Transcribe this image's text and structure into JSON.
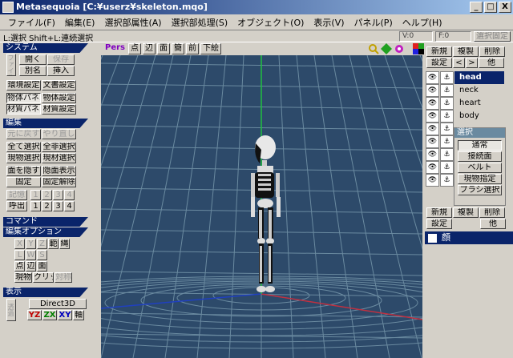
{
  "window": {
    "title": "Metasequoia [C:¥userz¥skeleton.mqo]",
    "buttons": [
      "_",
      "□",
      "X"
    ]
  },
  "menu": [
    "ファイル(F)",
    "編集(E)",
    "選択部属性(A)",
    "選択部処理(S)",
    "オブジェクト(O)",
    "表示(V)",
    "パネル(P)",
    "ヘルプ(H)"
  ],
  "status": {
    "hint": "L:選択  Shift+L:連続選択",
    "v": "V:0",
    "f": "F:0",
    "fix": "選択固定"
  },
  "left": {
    "system_head": "システム",
    "system_rows": [
      [
        "開く",
        "保存"
      ],
      [
        "別名",
        "挿入"
      ]
    ],
    "system_side": "ファイル",
    "env": [
      "環境設定",
      "文書設定"
    ],
    "panels": [
      [
        "物体パネル",
        "物体設定"
      ],
      [
        "材質パネル",
        "材質設定"
      ]
    ],
    "edit_head": "編集",
    "undo": [
      "元に戻す",
      "やり直し"
    ],
    "select": [
      [
        "全て選択",
        "全非選択"
      ],
      [
        "現物選択",
        "現材選択"
      ]
    ],
    "hide": [
      [
        "面を隠す",
        "隠面表示"
      ],
      [
        "固定",
        "固定解除"
      ]
    ],
    "memory": [
      "記憶",
      "呼出"
    ],
    "nums": [
      "1",
      "2",
      "3",
      "4"
    ],
    "cmd_head": "コマンド",
    "opt_head": "編集オプション",
    "xyz": [
      "X",
      "Y",
      "Z",
      "範",
      "縄"
    ],
    "luvws": [
      "L",
      "W",
      "S"
    ],
    "pts": [
      "点",
      "辺",
      "面"
    ],
    "objs": [
      "現物",
      "クリッド",
      "対称"
    ],
    "disp_head": "表示",
    "d3d": "Direct3D",
    "axes": [
      "YZ",
      "ZX",
      "XY",
      "軸"
    ],
    "side2": "透過"
  },
  "viewport": {
    "pers": "Pers",
    "modes": [
      "点",
      "辺",
      "面",
      "簡",
      "前",
      "下絵"
    ],
    "colors": {
      "bg": "#2d4a6a",
      "grid": "#6a8aa0",
      "yaxis": "#20c040",
      "xaxis": "#c03040",
      "zaxis": "#2040c0"
    }
  },
  "right": {
    "top_btns": [
      "新規",
      "複製",
      "削除"
    ],
    "top_btns2": [
      "設定",
      "<",
      ">",
      "他"
    ],
    "objects": [
      "head",
      "neck",
      "heart",
      "body"
    ],
    "select_title": "選択",
    "select_btns": [
      "通常",
      "接続面",
      "ベルト",
      "現物指定",
      "ブラシ選択"
    ],
    "mat_btns": [
      "新規",
      "複製",
      "削除"
    ],
    "mat_btns2": [
      "設定",
      "他"
    ],
    "materials": [
      "顔"
    ]
  }
}
